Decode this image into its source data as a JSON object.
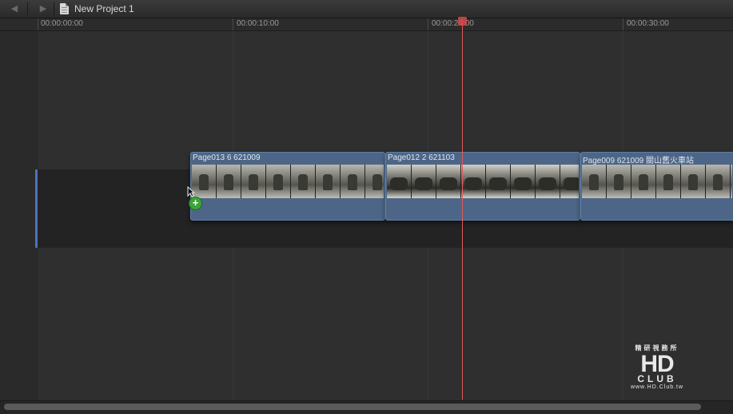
{
  "window": {
    "project_title": "New Project 1"
  },
  "ruler": {
    "timecodes": [
      "00:00:00:00",
      "00:00:10:00",
      "00:00:20:00",
      "00:00:30:00"
    ]
  },
  "clips": [
    {
      "name": "Page013 6 621009"
    },
    {
      "name": "Page012 2 621103"
    },
    {
      "name": "Page009 621009 關山舊火車站"
    }
  ],
  "watermark": {
    "top": "精研視務所",
    "logo": "HD",
    "sub": "CLUB",
    "url": "www.HD.Club.tw"
  },
  "colors": {
    "playhead": "#e05a5a",
    "clip": "#4d6687",
    "add_badge": "#3aa63a"
  },
  "icons": {
    "back": "triangle-left",
    "forward": "triangle-right",
    "document": "document-icon"
  }
}
